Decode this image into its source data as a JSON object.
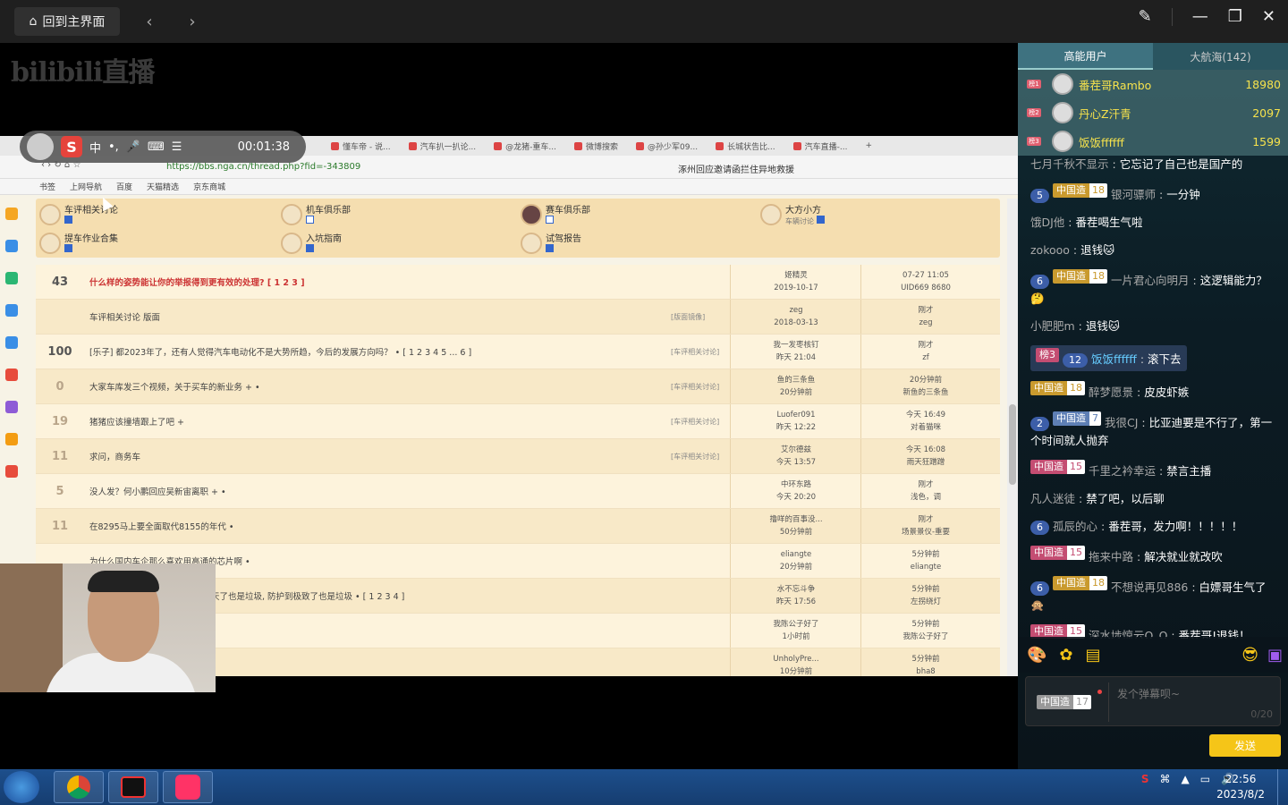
{
  "topbar": {
    "home_label": "回到主界面",
    "back": "‹",
    "forward": "›"
  },
  "logo": "bilibili直播",
  "ime": {
    "lang": "中",
    "punct": "•,",
    "timer": "00:01:38"
  },
  "browser": {
    "tabs": [
      "懂车帝 - 说...",
      "汽车扒一扒论...",
      "@龙猪-重车...",
      "微博搜索",
      "@孙少军09...",
      "长城状告比...",
      "汽车直播-..."
    ],
    "url": "https://bbs.nga.cn/thread.php?fid=-343809",
    "search": "涿州回应邀请函拦住异地救援",
    "bookmarks": [
      "书签",
      "上网导航",
      "百度",
      "天猫精选",
      "京东商城"
    ]
  },
  "forum": {
    "subforums": [
      {
        "name": "车评相关讨论",
        "note": ""
      },
      {
        "name": "机车俱乐部",
        "note": ""
      },
      {
        "name": "赛车俱乐部",
        "note": ""
      },
      {
        "name": "大方小方",
        "note": "车辆讨论"
      },
      {
        "name": "提车作业合集",
        "note": ""
      },
      {
        "name": "入坑指南",
        "note": ""
      },
      {
        "name": "试驾报告",
        "note": ""
      }
    ],
    "threads": [
      {
        "num": "43",
        "title": "什么样的姿势能让你的举报得到更有效的处理?   [ 1 2 3 ]",
        "tag": "",
        "author": "姬精灵",
        "author_time": "2019-10-17",
        "last": "07-27 11:05",
        "last_user": "UID669 8680"
      },
      {
        "num": "",
        "title": "车评相关讨论   版面",
        "tag": "[版面镜像]",
        "author": "zeg",
        "author_time": "2018-03-13",
        "last": "刚才",
        "last_user": "zeg"
      },
      {
        "num": "100",
        "title": "[乐子] 都2023年了，还有人觉得汽车电动化不是大势所趋，今后的发展方向吗？  •  [ 1 2 3 4 5 ... 6 ]",
        "tag": "[车评相关讨论]",
        "author": "我一发枣核钉",
        "author_time": "昨天 21:04",
        "last": "刚才",
        "last_user": "zf"
      },
      {
        "num": "0",
        "title": "大家车库发三个视频，关于买车的新业务  + •",
        "tag": "[车评相关讨论]",
        "author": "鱼的三条鱼",
        "author_time": "20分钟前",
        "last": "20分钟前",
        "last_user": "新鱼的三条鱼"
      },
      {
        "num": "19",
        "title": "猪猪应该撞墙跟上了吧  +",
        "tag": "[车评相关讨论]",
        "author": "Luofer091",
        "author_time": "昨天 12:22",
        "last": "今天 16:49",
        "last_user": "对着猫咪"
      },
      {
        "num": "11",
        "title": "求问，商务车",
        "tag": "[车评相关讨论]",
        "author": "艾尔德兹",
        "author_time": "今天 13:57",
        "last": "今天 16:08",
        "last_user": "雨天狂蹭蹭"
      },
      {
        "num": "5",
        "title": "没人发？何小鹏回应吴新宙离职 + •",
        "tag": "",
        "author": "中环东路",
        "author_time": "今天 20:20",
        "last": "刚才",
        "last_user": "浅色，调"
      },
      {
        "num": "11",
        "title": "在8295马上要全面取代8155的年代  •",
        "tag": "",
        "author": "撸咩的百事没...",
        "author_time": "50分钟前",
        "last": "刚才",
        "last_user": "场景景仪-重要"
      },
      {
        "num": "",
        "title": "为什么国内车企那么喜欢用高通的芯片啊  •",
        "tag": "",
        "author": "eliangte",
        "author_time": "20分钟前",
        "last": "5分钟前",
        "last_user": "eliangte"
      },
      {
        "num": "",
        "title": "天了也是垃圾, 防护到极致了也是垃圾  •   [ 1 2 3 4 ]",
        "tag": "",
        "author": "水不忘斗争",
        "author_time": "昨天 17:56",
        "last": "5分钟前",
        "last_user": "左拐绕灯"
      },
      {
        "num": "",
        "title": "",
        "tag": "",
        "author": "我陈公子好了",
        "author_time": "1小时前",
        "last": "5分钟前",
        "last_user": "我陈公子好了"
      },
      {
        "num": "",
        "title": "",
        "tag": "",
        "author": "UnholyPre...",
        "author_time": "10分钟前",
        "last": "5分钟前",
        "last_user": "bha8"
      }
    ]
  },
  "panel": {
    "tabs": [
      "高能用户",
      "大航海(142)"
    ],
    "ranks": [
      {
        "badge": "榜1",
        "name": "番茬哥Rambo",
        "score": "18980"
      },
      {
        "badge": "榜2",
        "name": "丹心Z汗青",
        "score": "2097"
      },
      {
        "badge": "榜3",
        "name": "饭饭ffffff",
        "score": "1599"
      }
    ],
    "chat": [
      {
        "lv": "",
        "medal": "",
        "medal_lv": "",
        "user": "七月千秋不显示",
        "text": "它忘记了自己也是国产的"
      },
      {
        "lv": "5",
        "medal": "中国造",
        "medal_lv": "18",
        "user": "银河骠师",
        "text": "一分钟"
      },
      {
        "lv": "",
        "medal": "",
        "medal_lv": "",
        "user": "饿DJ他",
        "text": "番茬喝生气啦"
      },
      {
        "lv": "",
        "medal": "",
        "medal_lv": "",
        "user": "zokooo",
        "text": "退钱🐱"
      },
      {
        "lv": "6",
        "medal": "中国造",
        "medal_lv": "18",
        "user": "一片君心向明月",
        "text": "这逻辑能力？🤔"
      },
      {
        "lv": "",
        "medal": "",
        "medal_lv": "",
        "user": "小肥肥m",
        "text": "退钱🐱"
      },
      {
        "lv": "12",
        "medal": "",
        "medal_lv": "",
        "user": "饭饭ffffff",
        "text": "滚下去",
        "rank": "榜3"
      },
      {
        "lv": "",
        "medal": "中国造",
        "medal_lv": "18",
        "user": "醉梦愿景",
        "text": "皮皮虾嫉"
      },
      {
        "lv": "2",
        "medal": "中国造",
        "medal_lv": "7",
        "user": "我很CJ",
        "text": "比亚迪要是不行了，第一个时间就人抛弃"
      },
      {
        "lv": "",
        "medal": "中国造",
        "medal_lv": "15",
        "user": "千里之衿幸运",
        "text": "禁言主播"
      },
      {
        "lv": "",
        "medal": "",
        "medal_lv": "",
        "user": "凡人迷徒",
        "text": "禁了吧，以后聊"
      },
      {
        "lv": "6",
        "medal": "",
        "medal_lv": "",
        "user": "孤辰的心",
        "text": "番茬哥，发力啊！！！！！"
      },
      {
        "lv": "",
        "medal": "中国造",
        "medal_lv": "15",
        "user": "拖来中路",
        "text": "解决就业就改吹"
      },
      {
        "lv": "6",
        "medal": "中国造",
        "medal_lv": "18",
        "user": "不想说再见886",
        "text": "白嫖哥生气了🙊"
      },
      {
        "lv": "",
        "medal": "中国造",
        "medal_lv": "15",
        "user": "深水埗惊云O_O",
        "text": "番茬哥!退钱！"
      }
    ],
    "input": {
      "medal": "中国造",
      "medal_lv": "17",
      "placeholder": "发个弹幕呗~",
      "counter": "0/20",
      "send": "发送"
    }
  },
  "taskbar": {
    "time": "22:56",
    "date": "2023/8/2"
  }
}
